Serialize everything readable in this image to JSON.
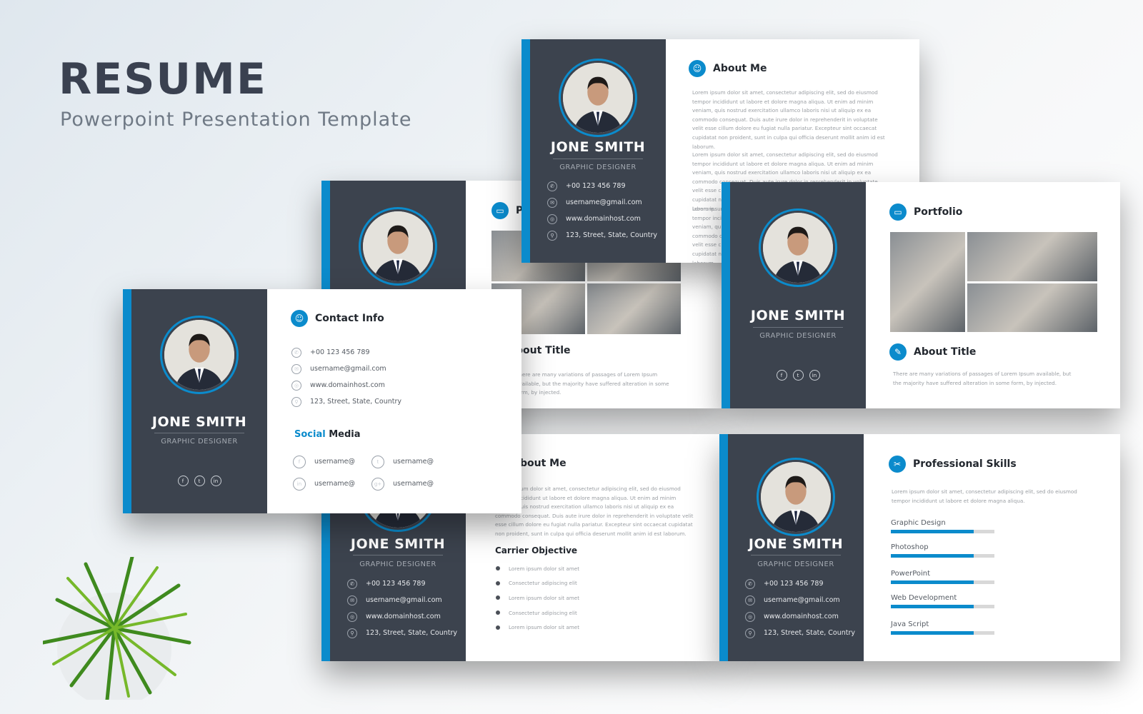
{
  "hero": {
    "title": "RESUME",
    "subtitle": "Powerpoint Presentation Template"
  },
  "colors": {
    "accent": "#0b8bcc",
    "sidebar": "#3c434e"
  },
  "person": {
    "name": "JONE SMITH",
    "role": "GRAPHIC DESIGNER"
  },
  "contact": {
    "phone": "+00 123 456 789",
    "email": "username@gmail.com",
    "web": "www.domainhost.com",
    "address": "123, Street, State, Country"
  },
  "headings": {
    "about_me": "About Me",
    "portfolio": "Portfolio",
    "about_title": "About Title",
    "contact_info": "Contact Info",
    "social_media_1": "Social",
    "social_media_2": " Media",
    "carrier_objective": "Carrier Objective",
    "professional_skills": "Professional Skills",
    "portfolio_partial": "P",
    "about_title_partial": "bout Title",
    "about_me_partial": "bout Me"
  },
  "lorem": {
    "about": "Lorem ipsum dolor sit amet, consectetur adipiscing elit, sed do eiusmod tempor incididunt ut labore et dolore magna aliqua. Ut enim ad minim veniam, quis nostrud exercitation ullamco laboris nisi ut aliquip ex ea commodo consequat. Duis aute irure dolor in reprehenderit in voluptate velit esse cillum dolore eu fugiat nulla pariatur. Excepteur sint occaecat cupidatat non proident, sunt in culpa qui officia deserunt mollit anim id est laborum.",
    "about_title": "There are many variations of passages of Lorem Ipsum available, but the majority have suffered alteration in some form, by injected.",
    "skills": "Lorem ipsum dolor sit amet, consectetur adipiscing elit, sed do eiusmod tempor incididunt ut labore et dolore magna aliqua."
  },
  "objectives": [
    "Lorem ipsum dolor sit amet",
    "Consectetur adipiscing elit",
    "Lorem ipsum dolor sit amet",
    "Consectetur adipiscing elit",
    "Lorem ipsum dolor sit amet"
  ],
  "social": {
    "facebook": "username@",
    "twitter": "username@",
    "linkedin": "username@",
    "googleplus": "username@"
  },
  "skills": [
    {
      "label": "Graphic Design",
      "percent": 80
    },
    {
      "label": "Photoshop",
      "percent": 80
    },
    {
      "label": "PowerPoint",
      "percent": 80
    },
    {
      "label": "Web Development",
      "percent": 80
    },
    {
      "label": "Java Script",
      "percent": 80
    }
  ],
  "icons": {
    "phone": "phone-icon",
    "email": "envelope-icon",
    "web": "globe-icon",
    "address": "map-pin-icon",
    "facebook": "facebook-icon",
    "twitter": "twitter-icon",
    "linkedin": "linkedin-icon",
    "googleplus": "google-plus-icon"
  }
}
